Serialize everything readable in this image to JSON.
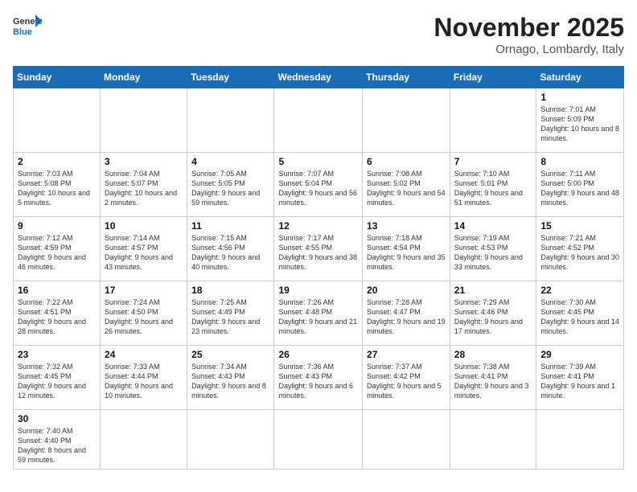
{
  "header": {
    "logo_general": "General",
    "logo_blue": "Blue",
    "month_title": "November 2025",
    "location": "Ornago, Lombardy, Italy"
  },
  "days_of_week": [
    "Sunday",
    "Monday",
    "Tuesday",
    "Wednesday",
    "Thursday",
    "Friday",
    "Saturday"
  ],
  "weeks": [
    [
      {
        "num": "",
        "info": ""
      },
      {
        "num": "",
        "info": ""
      },
      {
        "num": "",
        "info": ""
      },
      {
        "num": "",
        "info": ""
      },
      {
        "num": "",
        "info": ""
      },
      {
        "num": "",
        "info": ""
      },
      {
        "num": "1",
        "info": "Sunrise: 7:01 AM\nSunset: 5:09 PM\nDaylight: 10 hours\nand 8 minutes."
      }
    ],
    [
      {
        "num": "2",
        "info": "Sunrise: 7:03 AM\nSunset: 5:08 PM\nDaylight: 10 hours\nand 5 minutes."
      },
      {
        "num": "3",
        "info": "Sunrise: 7:04 AM\nSunset: 5:07 PM\nDaylight: 10 hours\nand 2 minutes."
      },
      {
        "num": "4",
        "info": "Sunrise: 7:05 AM\nSunset: 5:05 PM\nDaylight: 9 hours\nand 59 minutes."
      },
      {
        "num": "5",
        "info": "Sunrise: 7:07 AM\nSunset: 5:04 PM\nDaylight: 9 hours\nand 56 minutes."
      },
      {
        "num": "6",
        "info": "Sunrise: 7:08 AM\nSunset: 5:02 PM\nDaylight: 9 hours\nand 54 minutes."
      },
      {
        "num": "7",
        "info": "Sunrise: 7:10 AM\nSunset: 5:01 PM\nDaylight: 9 hours\nand 51 minutes."
      },
      {
        "num": "8",
        "info": "Sunrise: 7:11 AM\nSunset: 5:00 PM\nDaylight: 9 hours\nand 48 minutes."
      }
    ],
    [
      {
        "num": "9",
        "info": "Sunrise: 7:12 AM\nSunset: 4:59 PM\nDaylight: 9 hours\nand 46 minutes."
      },
      {
        "num": "10",
        "info": "Sunrise: 7:14 AM\nSunset: 4:57 PM\nDaylight: 9 hours\nand 43 minutes."
      },
      {
        "num": "11",
        "info": "Sunrise: 7:15 AM\nSunset: 4:56 PM\nDaylight: 9 hours\nand 40 minutes."
      },
      {
        "num": "12",
        "info": "Sunrise: 7:17 AM\nSunset: 4:55 PM\nDaylight: 9 hours\nand 38 minutes."
      },
      {
        "num": "13",
        "info": "Sunrise: 7:18 AM\nSunset: 4:54 PM\nDaylight: 9 hours\nand 35 minutes."
      },
      {
        "num": "14",
        "info": "Sunrise: 7:19 AM\nSunset: 4:53 PM\nDaylight: 9 hours\nand 33 minutes."
      },
      {
        "num": "15",
        "info": "Sunrise: 7:21 AM\nSunset: 4:52 PM\nDaylight: 9 hours\nand 30 minutes."
      }
    ],
    [
      {
        "num": "16",
        "info": "Sunrise: 7:22 AM\nSunset: 4:51 PM\nDaylight: 9 hours\nand 28 minutes."
      },
      {
        "num": "17",
        "info": "Sunrise: 7:24 AM\nSunset: 4:50 PM\nDaylight: 9 hours\nand 26 minutes."
      },
      {
        "num": "18",
        "info": "Sunrise: 7:25 AM\nSunset: 4:49 PM\nDaylight: 9 hours\nand 23 minutes."
      },
      {
        "num": "19",
        "info": "Sunrise: 7:26 AM\nSunset: 4:48 PM\nDaylight: 9 hours\nand 21 minutes."
      },
      {
        "num": "20",
        "info": "Sunrise: 7:28 AM\nSunset: 4:47 PM\nDaylight: 9 hours\nand 19 minutes."
      },
      {
        "num": "21",
        "info": "Sunrise: 7:29 AM\nSunset: 4:46 PM\nDaylight: 9 hours\nand 17 minutes."
      },
      {
        "num": "22",
        "info": "Sunrise: 7:30 AM\nSunset: 4:45 PM\nDaylight: 9 hours\nand 14 minutes."
      }
    ],
    [
      {
        "num": "23",
        "info": "Sunrise: 7:32 AM\nSunset: 4:45 PM\nDaylight: 9 hours\nand 12 minutes."
      },
      {
        "num": "24",
        "info": "Sunrise: 7:33 AM\nSunset: 4:44 PM\nDaylight: 9 hours\nand 10 minutes."
      },
      {
        "num": "25",
        "info": "Sunrise: 7:34 AM\nSunset: 4:43 PM\nDaylight: 9 hours\nand 8 minutes."
      },
      {
        "num": "26",
        "info": "Sunrise: 7:36 AM\nSunset: 4:43 PM\nDaylight: 9 hours\nand 6 minutes."
      },
      {
        "num": "27",
        "info": "Sunrise: 7:37 AM\nSunset: 4:42 PM\nDaylight: 9 hours\nand 5 minutes."
      },
      {
        "num": "28",
        "info": "Sunrise: 7:38 AM\nSunset: 4:41 PM\nDaylight: 9 hours\nand 3 minutes."
      },
      {
        "num": "29",
        "info": "Sunrise: 7:39 AM\nSunset: 4:41 PM\nDaylight: 9 hours\nand 1 minute."
      }
    ],
    [
      {
        "num": "30",
        "info": "Sunrise: 7:40 AM\nSunset: 4:40 PM\nDaylight: 8 hours\nand 59 minutes."
      },
      {
        "num": "",
        "info": ""
      },
      {
        "num": "",
        "info": ""
      },
      {
        "num": "",
        "info": ""
      },
      {
        "num": "",
        "info": ""
      },
      {
        "num": "",
        "info": ""
      },
      {
        "num": "",
        "info": ""
      }
    ]
  ]
}
